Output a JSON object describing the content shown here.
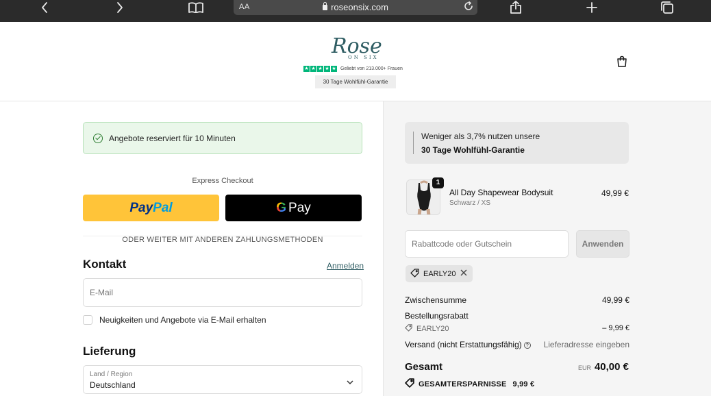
{
  "browser": {
    "text_size_label": "AA",
    "url": "roseonsix.com"
  },
  "header": {
    "logo_text": "Rose",
    "logo_sub": "ON SIX",
    "trust_text": "Geliebt von 213.000+ Frauen",
    "guarantee_badge": "30 Tage Wohlfühl-Garantie"
  },
  "checkout": {
    "notice": "Angebote reserviert für 10 Minuten",
    "express_label": "Express Checkout",
    "paypal_part1": "Pay",
    "paypal_part2": "Pal",
    "gpay_label": "Pay",
    "divider": "ODER WEITER MIT ANDEREN ZAHLUNGSMETHODEN",
    "contact": {
      "heading": "Kontakt",
      "login_link": "Anmelden",
      "email_placeholder": "E-Mail",
      "newsletter_label": "Neuigkeiten und Angebote via E-Mail erhalten"
    },
    "delivery": {
      "heading": "Lieferung",
      "country_label": "Land / Region",
      "country_value": "Deutschland"
    }
  },
  "summary": {
    "promo_line1": "Weniger als 3,7% nutzen unsere",
    "promo_line2": "30 Tage Wohlfühl-Garantie",
    "product": {
      "quantity": "1",
      "name": "All Day Shapewear Bodysuit",
      "variant": "Schwarz / XS",
      "price": "49,99 €"
    },
    "discount_placeholder": "Rabattcode oder Gutschein",
    "apply_label": "Anwenden",
    "applied_code": "EARLY20",
    "subtotal_label": "Zwischensumme",
    "subtotal_value": "49,99 €",
    "order_discount_label": "Bestellungsrabatt",
    "order_discount_code": "EARLY20",
    "order_discount_value": "– 9,99 €",
    "shipping_label": "Versand (nicht Erstattungsfähig)",
    "shipping_value": "Lieferadresse eingeben",
    "total_label": "Gesamt",
    "total_currency": "EUR",
    "total_value": "40,00 €",
    "savings_label": "GESAMTERSPARNISSE",
    "savings_value": "9,99 €"
  },
  "colors": {
    "paypal_yellow": "#ffc439",
    "gpay_black": "#000000",
    "notice_bg": "#eaf7ea",
    "trustpilot_green": "#00b67a",
    "brand_teal": "#2f5d63"
  }
}
